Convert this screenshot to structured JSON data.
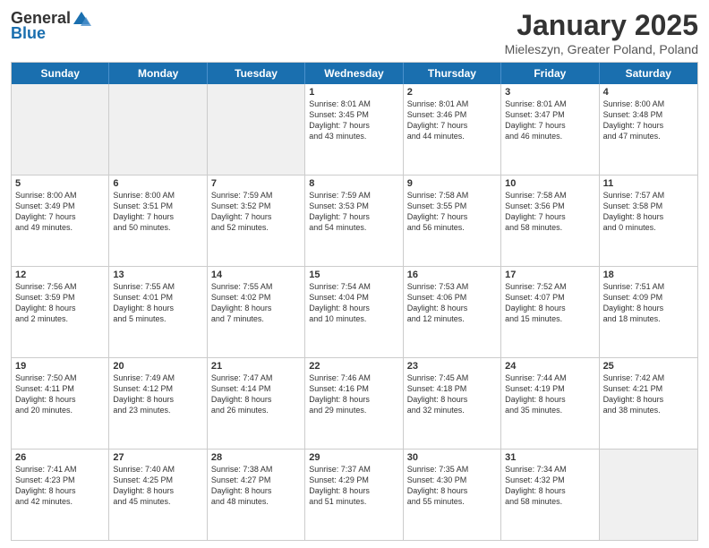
{
  "header": {
    "logo_general": "General",
    "logo_blue": "Blue",
    "month_title": "January 2025",
    "location": "Mieleszyn, Greater Poland, Poland"
  },
  "weekdays": [
    "Sunday",
    "Monday",
    "Tuesday",
    "Wednesday",
    "Thursday",
    "Friday",
    "Saturday"
  ],
  "rows": [
    [
      {
        "day": "",
        "text": ""
      },
      {
        "day": "",
        "text": ""
      },
      {
        "day": "",
        "text": ""
      },
      {
        "day": "1",
        "text": "Sunrise: 8:01 AM\nSunset: 3:45 PM\nDaylight: 7 hours\nand 43 minutes."
      },
      {
        "day": "2",
        "text": "Sunrise: 8:01 AM\nSunset: 3:46 PM\nDaylight: 7 hours\nand 44 minutes."
      },
      {
        "day": "3",
        "text": "Sunrise: 8:01 AM\nSunset: 3:47 PM\nDaylight: 7 hours\nand 46 minutes."
      },
      {
        "day": "4",
        "text": "Sunrise: 8:00 AM\nSunset: 3:48 PM\nDaylight: 7 hours\nand 47 minutes."
      }
    ],
    [
      {
        "day": "5",
        "text": "Sunrise: 8:00 AM\nSunset: 3:49 PM\nDaylight: 7 hours\nand 49 minutes."
      },
      {
        "day": "6",
        "text": "Sunrise: 8:00 AM\nSunset: 3:51 PM\nDaylight: 7 hours\nand 50 minutes."
      },
      {
        "day": "7",
        "text": "Sunrise: 7:59 AM\nSunset: 3:52 PM\nDaylight: 7 hours\nand 52 minutes."
      },
      {
        "day": "8",
        "text": "Sunrise: 7:59 AM\nSunset: 3:53 PM\nDaylight: 7 hours\nand 54 minutes."
      },
      {
        "day": "9",
        "text": "Sunrise: 7:58 AM\nSunset: 3:55 PM\nDaylight: 7 hours\nand 56 minutes."
      },
      {
        "day": "10",
        "text": "Sunrise: 7:58 AM\nSunset: 3:56 PM\nDaylight: 7 hours\nand 58 minutes."
      },
      {
        "day": "11",
        "text": "Sunrise: 7:57 AM\nSunset: 3:58 PM\nDaylight: 8 hours\nand 0 minutes."
      }
    ],
    [
      {
        "day": "12",
        "text": "Sunrise: 7:56 AM\nSunset: 3:59 PM\nDaylight: 8 hours\nand 2 minutes."
      },
      {
        "day": "13",
        "text": "Sunrise: 7:55 AM\nSunset: 4:01 PM\nDaylight: 8 hours\nand 5 minutes."
      },
      {
        "day": "14",
        "text": "Sunrise: 7:55 AM\nSunset: 4:02 PM\nDaylight: 8 hours\nand 7 minutes."
      },
      {
        "day": "15",
        "text": "Sunrise: 7:54 AM\nSunset: 4:04 PM\nDaylight: 8 hours\nand 10 minutes."
      },
      {
        "day": "16",
        "text": "Sunrise: 7:53 AM\nSunset: 4:06 PM\nDaylight: 8 hours\nand 12 minutes."
      },
      {
        "day": "17",
        "text": "Sunrise: 7:52 AM\nSunset: 4:07 PM\nDaylight: 8 hours\nand 15 minutes."
      },
      {
        "day": "18",
        "text": "Sunrise: 7:51 AM\nSunset: 4:09 PM\nDaylight: 8 hours\nand 18 minutes."
      }
    ],
    [
      {
        "day": "19",
        "text": "Sunrise: 7:50 AM\nSunset: 4:11 PM\nDaylight: 8 hours\nand 20 minutes."
      },
      {
        "day": "20",
        "text": "Sunrise: 7:49 AM\nSunset: 4:12 PM\nDaylight: 8 hours\nand 23 minutes."
      },
      {
        "day": "21",
        "text": "Sunrise: 7:47 AM\nSunset: 4:14 PM\nDaylight: 8 hours\nand 26 minutes."
      },
      {
        "day": "22",
        "text": "Sunrise: 7:46 AM\nSunset: 4:16 PM\nDaylight: 8 hours\nand 29 minutes."
      },
      {
        "day": "23",
        "text": "Sunrise: 7:45 AM\nSunset: 4:18 PM\nDaylight: 8 hours\nand 32 minutes."
      },
      {
        "day": "24",
        "text": "Sunrise: 7:44 AM\nSunset: 4:19 PM\nDaylight: 8 hours\nand 35 minutes."
      },
      {
        "day": "25",
        "text": "Sunrise: 7:42 AM\nSunset: 4:21 PM\nDaylight: 8 hours\nand 38 minutes."
      }
    ],
    [
      {
        "day": "26",
        "text": "Sunrise: 7:41 AM\nSunset: 4:23 PM\nDaylight: 8 hours\nand 42 minutes."
      },
      {
        "day": "27",
        "text": "Sunrise: 7:40 AM\nSunset: 4:25 PM\nDaylight: 8 hours\nand 45 minutes."
      },
      {
        "day": "28",
        "text": "Sunrise: 7:38 AM\nSunset: 4:27 PM\nDaylight: 8 hours\nand 48 minutes."
      },
      {
        "day": "29",
        "text": "Sunrise: 7:37 AM\nSunset: 4:29 PM\nDaylight: 8 hours\nand 51 minutes."
      },
      {
        "day": "30",
        "text": "Sunrise: 7:35 AM\nSunset: 4:30 PM\nDaylight: 8 hours\nand 55 minutes."
      },
      {
        "day": "31",
        "text": "Sunrise: 7:34 AM\nSunset: 4:32 PM\nDaylight: 8 hours\nand 58 minutes."
      },
      {
        "day": "",
        "text": ""
      }
    ]
  ]
}
